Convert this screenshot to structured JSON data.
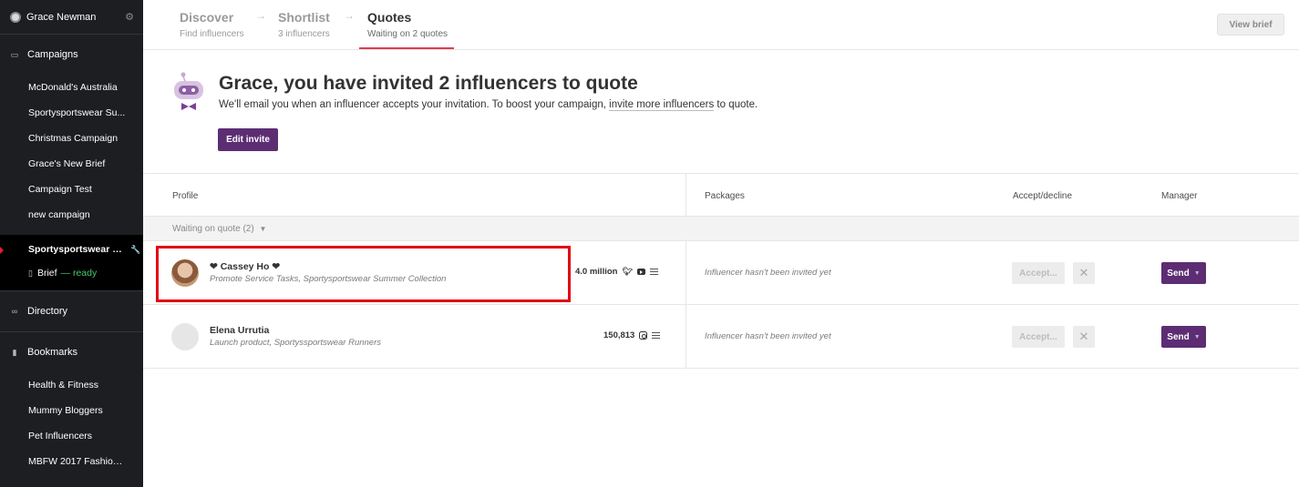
{
  "user": {
    "name": "Grace Newman"
  },
  "sidebar": {
    "campaigns_label": "Campaigns",
    "campaigns": [
      "McDonald's Australia",
      "Sportysportswear Su...",
      "Christmas Campaign",
      "Grace's New Brief",
      "Campaign Test",
      "new campaign"
    ],
    "active_campaign": "Sportysportswear S...",
    "brief_label": "Brief",
    "brief_status": "— ready",
    "directory_label": "Directory",
    "bookmarks_label": "Bookmarks",
    "bookmarks": [
      "Health & Fitness",
      "Mummy Bloggers",
      "Pet Influencers",
      "MBFW 2017 Fashion I..."
    ]
  },
  "steps": [
    {
      "title": "Discover",
      "subtitle": "Find influencers"
    },
    {
      "title": "Shortlist",
      "subtitle": "3 influencers"
    },
    {
      "title": "Quotes",
      "subtitle": "Waiting on 2 quotes"
    }
  ],
  "view_brief_label": "View brief",
  "banner": {
    "title": "Grace, you have invited 2 influencers to quote",
    "text_before": "We'll email you when an influencer accepts your invitation. To boost your campaign,",
    "link": "invite more influencers",
    "text_after": "to quote.",
    "edit_invite_label": "Edit invite"
  },
  "table": {
    "headers": {
      "profile": "Profile",
      "packages": "Packages",
      "accept": "Accept/decline",
      "manager": "Manager"
    },
    "group_label": "Waiting on quote (2)",
    "rows": [
      {
        "name": "❤ Cassey Ho ❤",
        "subtitle": "Promote Service Tasks, Sportysportswear Summer Collection",
        "followers": "4.0 million",
        "networks": [
          "twitter-icon",
          "youtube-icon",
          "blog-icon"
        ],
        "package_note": "Influencer hasn't been invited yet",
        "accept_label": "Accept...",
        "decline_label": "✕",
        "send_label": "Send"
      },
      {
        "name": "Elena Urrutia",
        "subtitle": "Launch product, Sportyssportswear Runners",
        "followers": "150,813",
        "networks": [
          "instagram-icon",
          "blog-icon"
        ],
        "package_note": "Influencer hasn't been invited yet",
        "accept_label": "Accept...",
        "decline_label": "✕",
        "send_label": "Send"
      }
    ]
  },
  "colors": {
    "brand_purple": "#5c2d73",
    "step_accent": "#e23b4e",
    "highlight": "#e30613",
    "ready_green": "#47c96a"
  }
}
